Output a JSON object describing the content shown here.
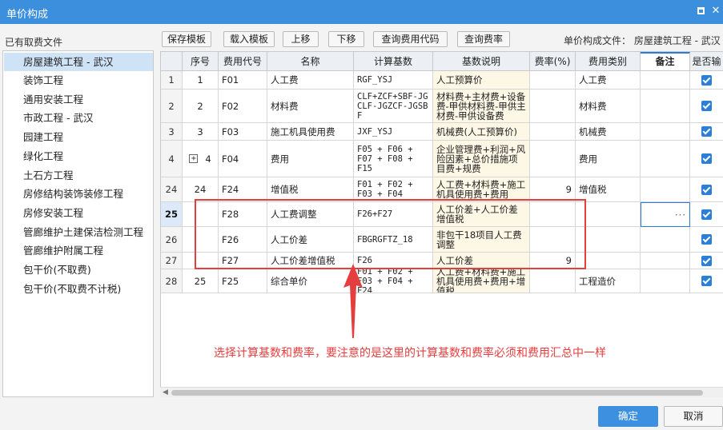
{
  "window": {
    "title": "单价构成",
    "maximize_icon": "maximize-icon",
    "close_glyph": "✕"
  },
  "left_panel": {
    "label": "已有取费文件",
    "items": [
      {
        "label": "房屋建筑工程 - 武汉",
        "selected": true
      },
      {
        "label": "装饰工程"
      },
      {
        "label": "通用安装工程"
      },
      {
        "label": "市政工程 - 武汉"
      },
      {
        "label": "园建工程"
      },
      {
        "label": "绿化工程"
      },
      {
        "label": "土石方工程"
      },
      {
        "label": "房修结构装饰装修工程"
      },
      {
        "label": "房修安装工程"
      },
      {
        "label": "管廊维护土建保洁检测工程"
      },
      {
        "label": "管廊维护附属工程"
      },
      {
        "label": "包干价(不取费)"
      },
      {
        "label": "包干价(不取费不计税)"
      }
    ]
  },
  "toolbar": {
    "buttons": [
      "保存模板",
      "载入模板",
      "上移",
      "下移",
      "查询费用代码",
      "查询费率"
    ],
    "file_label": "单价构成文件： 房屋建筑工程 - 武汉"
  },
  "table": {
    "headers": [
      "",
      "序号",
      "费用代号",
      "名称",
      "计算基数",
      "基数说明",
      "费率(%)",
      "费用类别",
      "备注",
      "是否输"
    ],
    "rows": [
      {
        "row_no": "1",
        "seq": "1",
        "code": "F01",
        "name": "人工费",
        "base": "RGF_YSJ",
        "desc": "人工预算价",
        "rate": "",
        "category": "人工费",
        "remark": "",
        "checked": true
      },
      {
        "row_no": "2",
        "seq": "2",
        "code": "F02",
        "name": "材料费",
        "base": "CLF+ZCF+SBF-JGCLF-JGZCF-JGSBF",
        "desc": "材料费+主材费+设备费-甲供材料费-甲供主材费-甲供设备费",
        "rate": "",
        "category": "材料费",
        "remark": "",
        "checked": true
      },
      {
        "row_no": "3",
        "seq": "3",
        "code": "F03",
        "name": "施工机具使用费",
        "base": "JXF_YSJ",
        "desc": "机械费(人工预算价)",
        "rate": "",
        "category": "机械费",
        "remark": "",
        "checked": true
      },
      {
        "row_no": "4",
        "seq": "4",
        "code": "F04",
        "name": "费用",
        "base": "F05 + F06 + F07 + F08 + F15",
        "desc": "企业管理费+利润+风险因素+总价措施项目费+规费",
        "rate": "",
        "category": "费用",
        "remark": "",
        "checked": true,
        "expand": "+"
      },
      {
        "row_no": "24",
        "seq": "24",
        "code": "F24",
        "name": "增值税",
        "base": "F01 + F02 + F03 + F04",
        "desc": "人工费+材料费+施工机具使用费+费用",
        "rate": "9",
        "category": "增值税",
        "remark": "",
        "checked": true
      },
      {
        "row_no": "25",
        "seq": "",
        "code": "F28",
        "name": "人工费调整",
        "base": "F26+F27",
        "desc": "人工价差+人工价差增值税",
        "rate": "",
        "category": "",
        "remark": "···",
        "checked": true,
        "current": true
      },
      {
        "row_no": "26",
        "seq": "",
        "code": "F26",
        "name": "人工价差",
        "base": "FBGRGFTZ_18",
        "desc": "非包干18项目人工费调整",
        "rate": "",
        "category": "",
        "remark": "",
        "checked": true
      },
      {
        "row_no": "27",
        "seq": "",
        "code": "F27",
        "name": "人工价差增值税",
        "base": "F26",
        "desc": "人工价差",
        "rate": "9",
        "category": "",
        "remark": "",
        "checked": true
      },
      {
        "row_no": "28",
        "seq": "25",
        "code": "F25",
        "name": "综合单价",
        "base": "F01 + F02 + F03 + F04 + F24",
        "desc": "人工费+材料费+施工机具使用费+费用+增值税",
        "rate": "",
        "category": "工程造价",
        "remark": "",
        "checked": true
      }
    ]
  },
  "annotation": {
    "text": "选择计算基数和费率，要注意的是这里的计算基数和费率必须和费用汇总中一样",
    "color": "#e53e3e"
  },
  "footer": {
    "ok_label": "确定",
    "cancel_label": "取消"
  },
  "colors": {
    "titlebar": "#3b8fdd",
    "accent": "#2b7fd8",
    "selection": "#cfe3f7"
  }
}
